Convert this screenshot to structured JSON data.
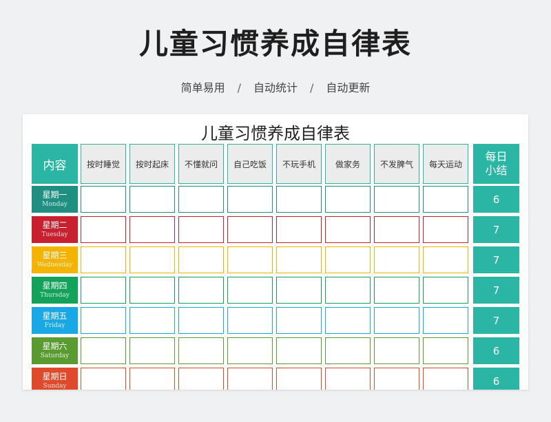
{
  "page": {
    "title": "儿童习惯养成自律表",
    "features": [
      "简单易用",
      "自动统计",
      "自动更新"
    ],
    "separator": "/"
  },
  "sheet": {
    "title": "儿童习惯养成自律表",
    "header_left": "内容",
    "header_right_line1": "每日",
    "header_right_line2": "小结",
    "habits": [
      "按时睡觉",
      "按时起床",
      "不懂就问",
      "自己吃饭",
      "不玩手机",
      "做家务",
      "不发脾气",
      "每天运动"
    ],
    "accent_color": "#2bb5a5",
    "days": [
      {
        "zh": "星期一",
        "en": "Monday",
        "color": "#1e8f80",
        "score": "6"
      },
      {
        "zh": "星期二",
        "en": "Tuesday",
        "color": "#c8202f",
        "score": "7"
      },
      {
        "zh": "星期三",
        "en": "Wednesday",
        "color": "#f5b301",
        "score": "7"
      },
      {
        "zh": "星期四",
        "en": "Thursday",
        "color": "#12a25a",
        "score": "7"
      },
      {
        "zh": "星期五",
        "en": "Friday",
        "color": "#1aa7e6",
        "score": "7"
      },
      {
        "zh": "星期六",
        "en": "Saturday",
        "color": "#5a9b31",
        "score": "6"
      },
      {
        "zh": "星期日",
        "en": "Sunday",
        "color": "#e04a2c",
        "score": "6"
      }
    ]
  }
}
